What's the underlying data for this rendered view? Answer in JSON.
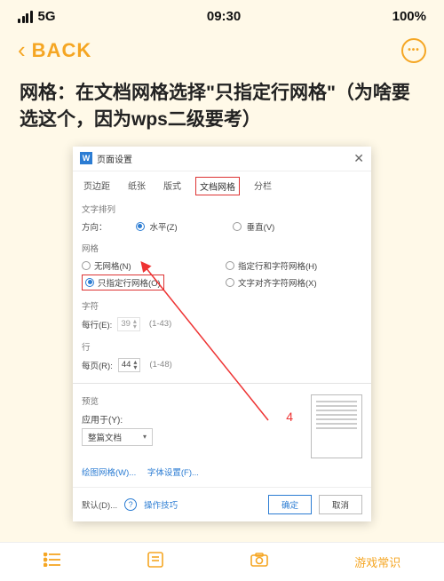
{
  "status": {
    "network": "5G",
    "time": "09:30",
    "battery": "100%"
  },
  "nav": {
    "back": "BACK"
  },
  "instruction": "网格：在文档网格选择\"只指定行网格\"（为啥要选这个，因为wps二级要考）",
  "dialog": {
    "title": "页面设置",
    "tabs": [
      "页边距",
      "纸张",
      "版式",
      "文档网格",
      "分栏"
    ],
    "active_tab": "文档网格",
    "text_dir": {
      "label": "文字排列",
      "dir_label": "方向：",
      "horizontal": "水平(Z)",
      "vertical": "垂直(V)"
    },
    "grid": {
      "label": "网格",
      "none": "无网格(N)",
      "row_char": "指定行和字符网格(H)",
      "row_only": "只指定行网格(O)",
      "align_char": "文字对齐字符网格(X)"
    },
    "chars": {
      "label": "字符",
      "per_row": "每行(E):",
      "value": "39",
      "range": "(1-43)"
    },
    "rows": {
      "label": "行",
      "per_page": "每页(R):",
      "value": "44",
      "range": "(1-48)"
    },
    "preview": {
      "label": "预览",
      "apply": "应用于(Y):",
      "scope": "整篇文档"
    },
    "links": {
      "draw_grid": "绘图网格(W)...",
      "font": "字体设置(F)..."
    },
    "bottom": {
      "default": "默认(D)...",
      "tips": "操作技巧",
      "ok": "确定",
      "cancel": "取消"
    },
    "annot_num": "4"
  },
  "appbar": {
    "tab4": "游戏常识"
  }
}
